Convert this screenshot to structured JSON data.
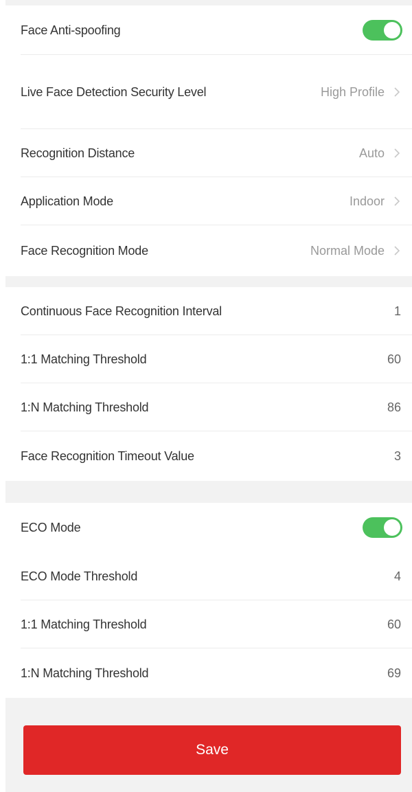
{
  "section1": {
    "face_anti_spoofing": {
      "label": "Face Anti-spoofing",
      "enabled": true
    },
    "liveness_level": {
      "label": "Live Face Detection Security Level",
      "value": "High Profile"
    },
    "recognition_distance": {
      "label": "Recognition Distance",
      "value": "Auto"
    },
    "application_mode": {
      "label": "Application Mode",
      "value": "Indoor"
    },
    "face_recognition_mode": {
      "label": "Face Recognition Mode",
      "value": "Normal Mode"
    }
  },
  "section2": {
    "continuous_interval": {
      "label": "Continuous Face Recognition Interval",
      "value": "1"
    },
    "matching_1_1": {
      "label": "1:1 Matching Threshold",
      "value": "60"
    },
    "matching_1_n": {
      "label": "1:N Matching Threshold",
      "value": "86"
    },
    "timeout_value": {
      "label": "Face Recognition Timeout Value",
      "value": "3"
    }
  },
  "section3": {
    "eco_mode": {
      "label": "ECO Mode",
      "enabled": true
    },
    "eco_threshold": {
      "label": "ECO Mode Threshold",
      "value": "4"
    },
    "eco_matching_1_1": {
      "label": "1:1 Matching Threshold",
      "value": "60"
    },
    "eco_matching_1_n": {
      "label": "1:N Matching Threshold",
      "value": "69"
    }
  },
  "save_label": "Save",
  "colors": {
    "toggle_on": "#4cc15c",
    "save_button": "#e02727",
    "background": "#f2f2f2"
  },
  "icons": {
    "row_arrow": "chevron-right-icon"
  }
}
